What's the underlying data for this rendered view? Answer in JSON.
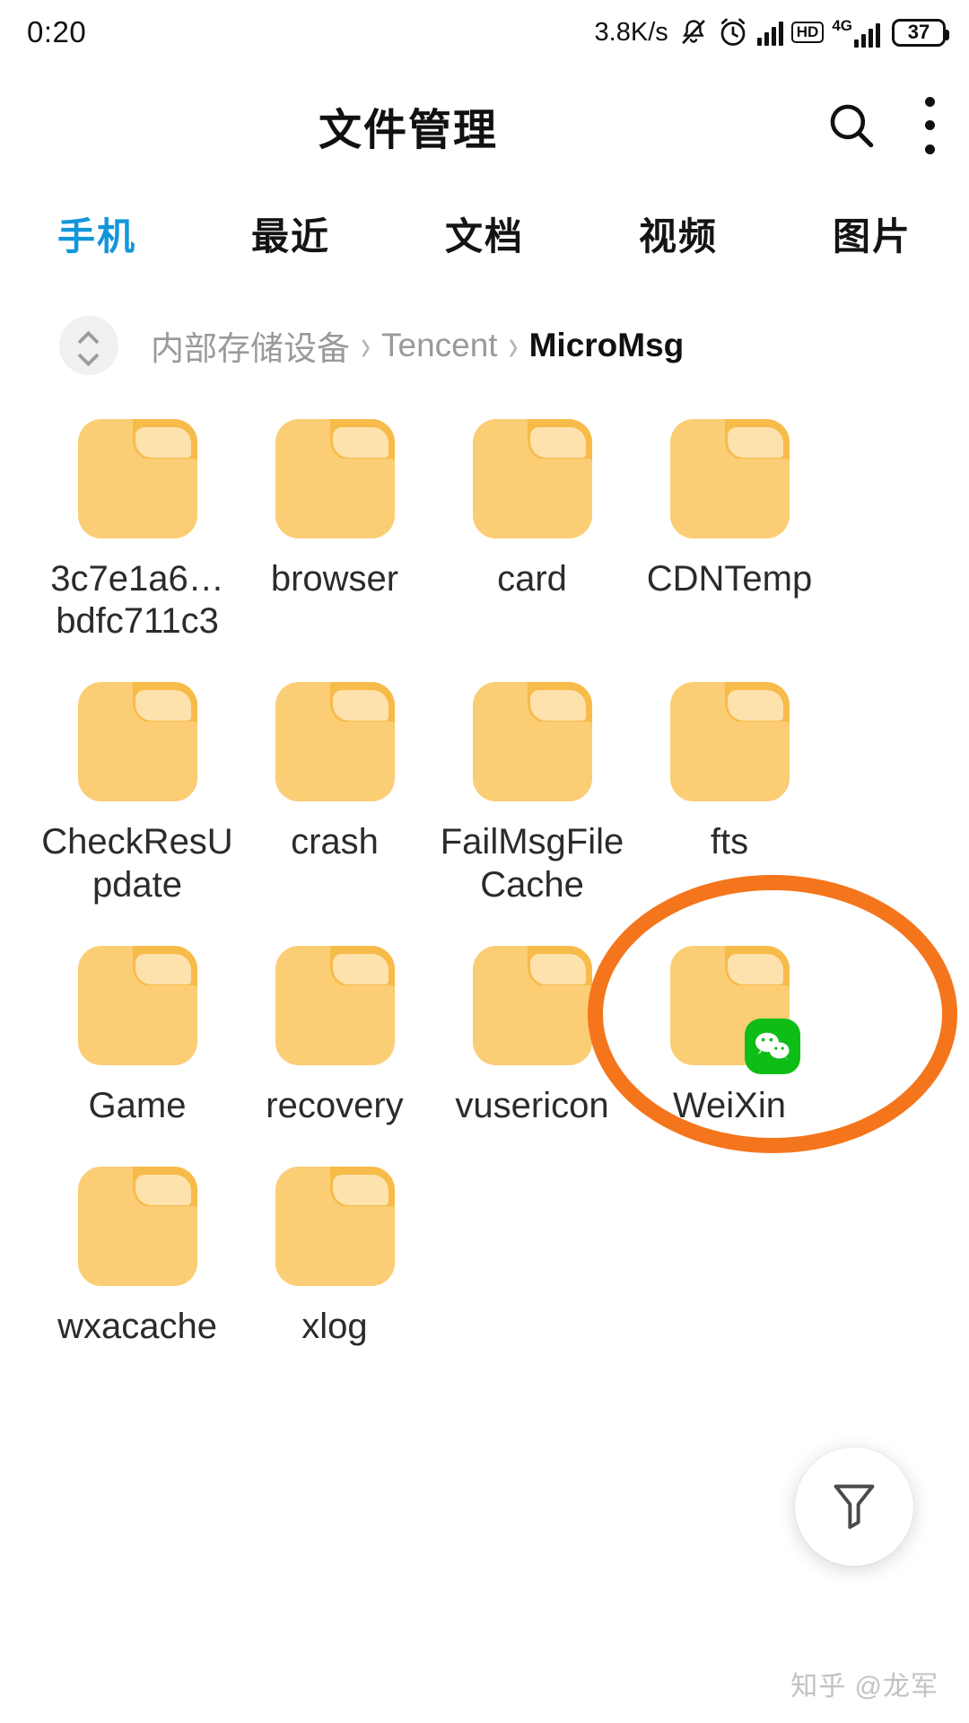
{
  "status_bar": {
    "time": "0:20",
    "network_speed": "3.8K/s",
    "hd_label": "HD",
    "network_type": "4G",
    "battery_level": "37",
    "icons": [
      "mute-bell-icon",
      "alarm-clock-icon",
      "signal-bars-icon",
      "hd-icon",
      "4g-signal-icon",
      "battery-icon"
    ]
  },
  "app_bar": {
    "title": "文件管理",
    "search_icon": "search-icon",
    "more_icon": "more-vertical-icon"
  },
  "tabs": [
    {
      "label": "手机",
      "active": true
    },
    {
      "label": "最近",
      "active": false
    },
    {
      "label": "文档",
      "active": false
    },
    {
      "label": "视频",
      "active": false
    },
    {
      "label": "图片",
      "active": false
    }
  ],
  "breadcrumb": {
    "toggle_icon": "chevron-up-down-icon",
    "separator": "›",
    "items": [
      {
        "label": "内部存储设备",
        "current": false
      },
      {
        "label": "Tencent",
        "current": false
      },
      {
        "label": "MicroMsg",
        "current": true
      }
    ]
  },
  "grid": {
    "rows": [
      [
        {
          "name": "3c7e1a6…\nbdfc711c3",
          "icon": "folder-icon",
          "badge": null
        },
        {
          "name": "browser",
          "icon": "folder-icon",
          "badge": null
        },
        {
          "name": "card",
          "icon": "folder-icon",
          "badge": null
        },
        {
          "name": "CDNTemp",
          "icon": "folder-icon",
          "badge": null
        }
      ],
      [
        {
          "name": "CheckResUpdate",
          "icon": "folder-icon",
          "badge": null
        },
        {
          "name": "crash",
          "icon": "folder-icon",
          "badge": null
        },
        {
          "name": "FailMsgFileCache",
          "icon": "folder-icon",
          "badge": null
        },
        {
          "name": "fts",
          "icon": "folder-icon",
          "badge": null
        }
      ],
      [
        {
          "name": "Game",
          "icon": "folder-icon",
          "badge": null
        },
        {
          "name": "recovery",
          "icon": "folder-icon",
          "badge": null
        },
        {
          "name": "vusericon",
          "icon": "folder-icon",
          "badge": null
        },
        {
          "name": "WeiXin",
          "icon": "folder-icon",
          "badge": "wechat-badge-icon"
        }
      ],
      [
        {
          "name": "wxacache",
          "icon": "folder-icon",
          "badge": null
        },
        {
          "name": "xlog",
          "icon": "folder-icon",
          "badge": null
        }
      ]
    ]
  },
  "annotation": {
    "type": "ellipse-highlight",
    "target": "WeiXin",
    "color": "#f4751c"
  },
  "fab": {
    "icon": "filter-funnel-icon",
    "label": ""
  },
  "watermark": {
    "text": "知乎 @龙军"
  },
  "colors": {
    "accent_tab": "#1296db",
    "folder": "#fbcd75",
    "folder_tab": "#f7bb4a",
    "folder_flap": "#fde2ae",
    "wechat_green": "#0ebd16",
    "annotation_orange": "#f4751c",
    "text_primary": "#2b2b2b",
    "text_muted": "#9a9a9a"
  }
}
